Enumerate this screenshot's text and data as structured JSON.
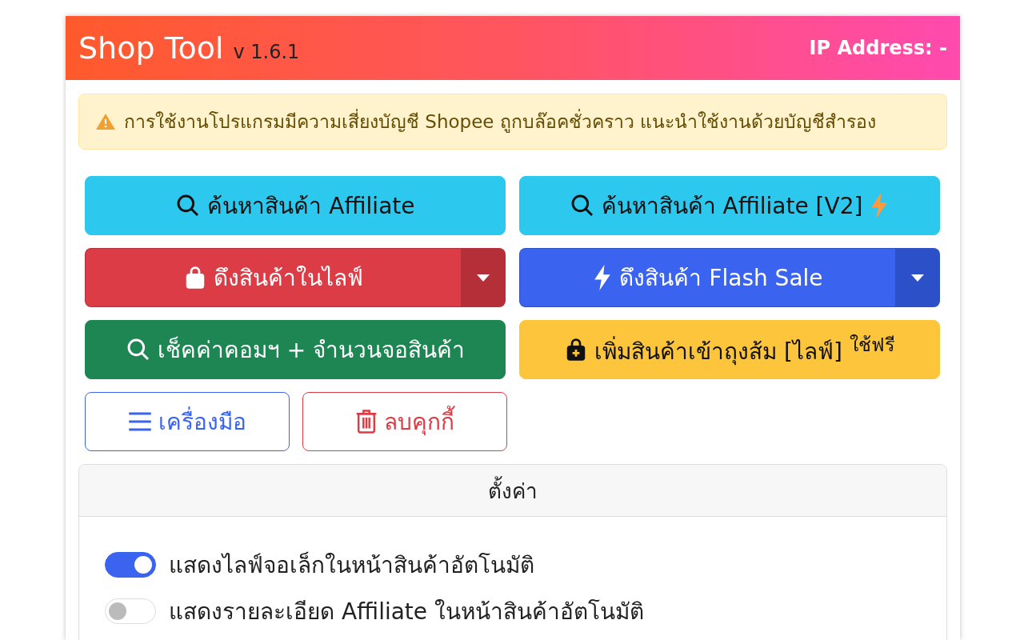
{
  "header": {
    "title": "Shop Tool",
    "version": "v 1.6.1",
    "ip_label": "IP Address: -"
  },
  "alert": {
    "text": "การใช้งานโปรแกรมมีความเสี่ยงบัญชี Shopee ถูกบล๊อคชั่วคราว แนะนำใช้งานด้วยบัญชีสำรอง"
  },
  "buttons": [
    {
      "label": "ค้นหาสินค้า Affiliate",
      "kind": "info",
      "dropdown": false
    },
    {
      "label": "ค้นหาสินค้า Affiliate [V2]",
      "kind": "info",
      "dropdown": false
    },
    {
      "label": "ดึงสินค้าในไลฟ์",
      "kind": "danger",
      "dropdown": true
    },
    {
      "label": "ดึงสินค้า Flash Sale",
      "kind": "primary",
      "dropdown": true
    },
    {
      "label": "เช็คค่าคอมฯ + จำนวนจอสินค้า",
      "kind": "success",
      "dropdown": false
    },
    {
      "label": "เพิ่มสินค้าเข้าถุงส้ม [ไลฟ์] $^{ใช้ฟรี}$",
      "kind": "warning",
      "dropdown": false
    }
  ],
  "small_buttons": [
    {
      "label": "เครื่องมือ",
      "kind": "outline-primary"
    },
    {
      "label": "ลบคุกกี้",
      "kind": "outline-danger"
    }
  ],
  "settings": {
    "title": "ตั้งค่า",
    "toggles": [
      {
        "label": "แสดงไลฟ์จอเล็กในหน้าสินค้าอัตโนมัติ",
        "on": true
      },
      {
        "label": "แสดงรายละเอียด Affiliate ในหน้าสินค้าอัตโนมัติ",
        "on": false
      }
    ]
  }
}
